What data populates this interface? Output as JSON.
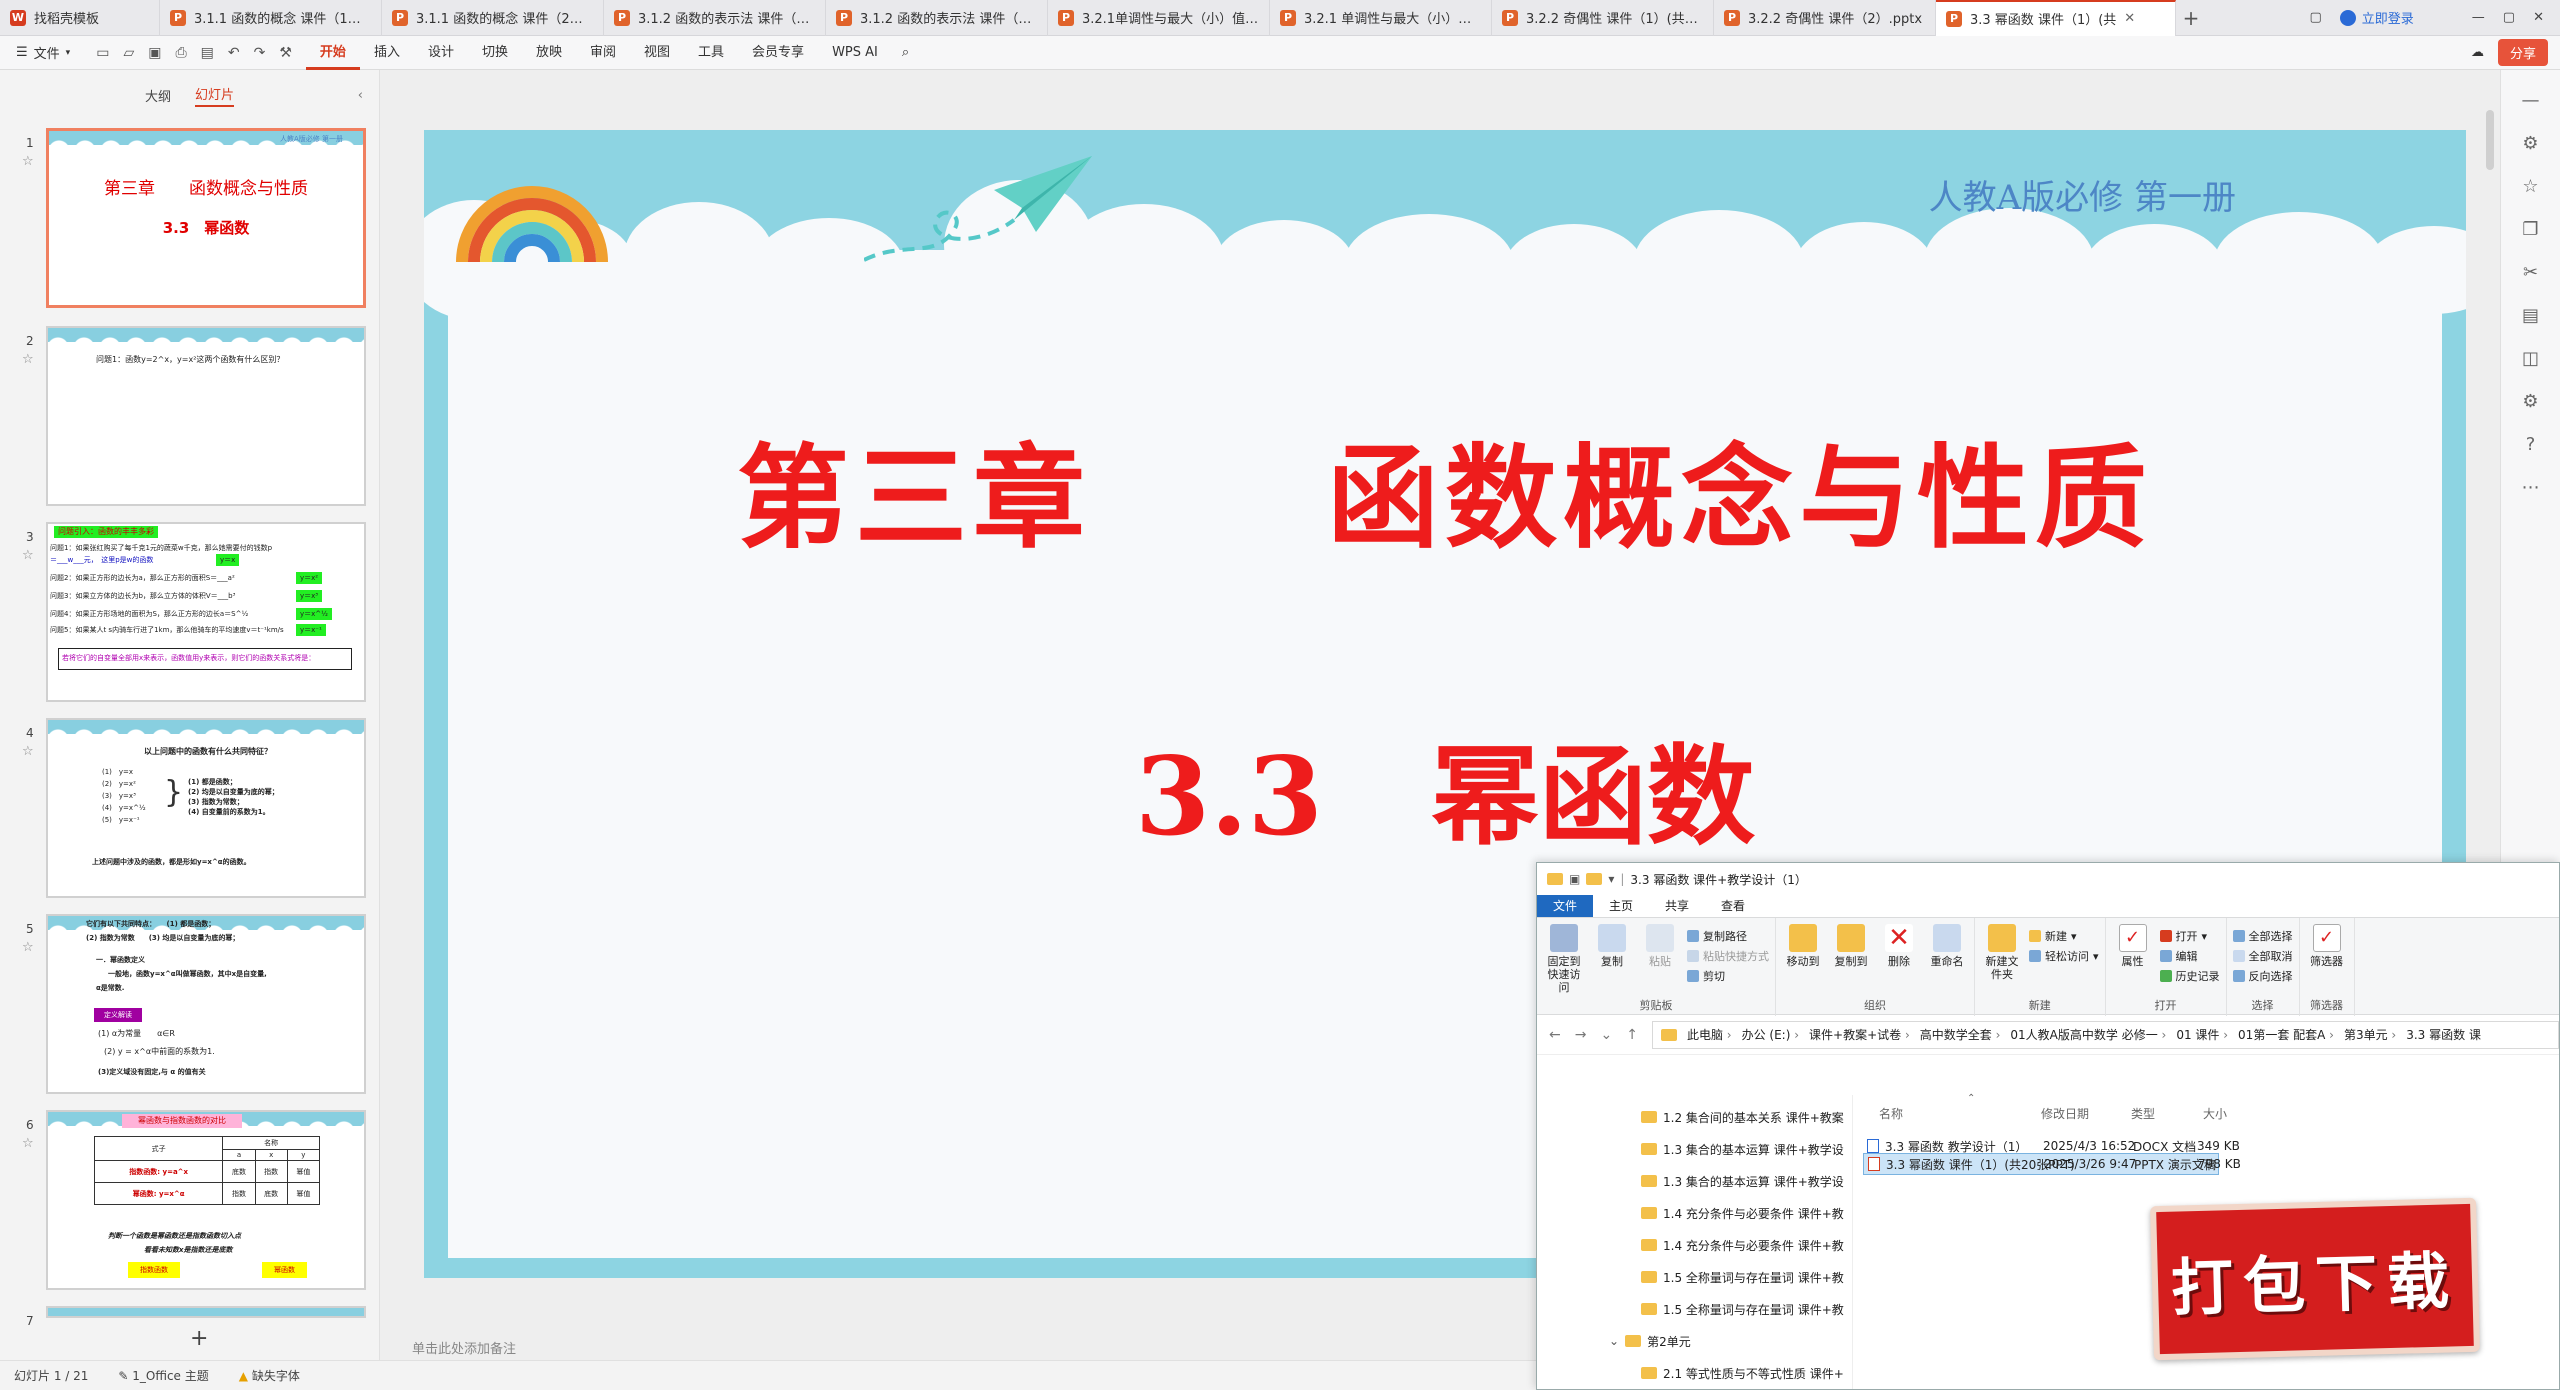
{
  "tabs": [
    {
      "label": "找稻壳模板",
      "icon": "wps-icon",
      "color": "#d63c1f",
      "letter": "W"
    },
    {
      "label": "3.1.1 函数的概念 课件（1）(共3",
      "icon": "ppt-icon",
      "color": "#e0632b",
      "letter": "P"
    },
    {
      "label": "3.1.1 函数的概念 课件（2）.pptx",
      "icon": "ppt-icon",
      "color": "#e0632b",
      "letter": "P"
    },
    {
      "label": "3.1.2 函数的表示法 课件（1）(共",
      "icon": "ppt-icon",
      "color": "#e0632b",
      "letter": "P"
    },
    {
      "label": "3.1.2 函数的表示法 课件（2）.p",
      "icon": "ppt-icon",
      "color": "#e0632b",
      "letter": "P"
    },
    {
      "label": "3.2.1单调性与最大（小）值 课件",
      "icon": "ppt-icon",
      "color": "#e0632b",
      "letter": "P"
    },
    {
      "label": "3.2.1 单调性与最大（小）值 课件",
      "icon": "ppt-icon",
      "color": "#e0632b",
      "letter": "P"
    },
    {
      "label": "3.2.2 奇偶性 课件（1）(共24张",
      "icon": "ppt-icon",
      "color": "#e0632b",
      "letter": "P"
    },
    {
      "label": "3.2.2 奇偶性 课件（2）.pptx",
      "icon": "ppt-icon",
      "color": "#e0632b",
      "letter": "P"
    },
    {
      "label": "3.3 幂函数 课件（1）(共",
      "icon": "ppt-icon",
      "color": "#e0632b",
      "letter": "P",
      "active": true
    }
  ],
  "login_label": "立即登录",
  "menu": {
    "file_label": "文件",
    "items": [
      "开始",
      "插入",
      "设计",
      "切换",
      "放映",
      "审阅",
      "视图",
      "工具",
      "会员专享",
      "WPS AI"
    ],
    "active": "开始",
    "share_label": "分享"
  },
  "panel": {
    "tab_outline": "大纲",
    "tab_slides": "幻灯片"
  },
  "thumbs": {
    "s1": {
      "num": "1",
      "line1": "第三章　　函数概念与性质",
      "line2": "3.3　幂函数",
      "corner": "人教A版必修 第一册"
    },
    "s2": {
      "num": "2",
      "line1": "问题1：函数y=2^x，y=x²这两个函数有什么区别？"
    },
    "s3": {
      "num": "3",
      "head": "问题引入：函数的丰丰多彩",
      "lines": [
        "问题1：如果张红购买了每千克1元的蔬菜w千克，那么她需要付的钱数p",
        "＝___w___元，　这里p是w的函数",
        "问题2：如果正方形的边长为a，那么正方形的面积S＝___a²",
        "问题3：如果立方体的边长为b，那么立方体的体积V＝___b³",
        "问题4：如果正方形场地的面积为S，那么正方形的边长a＝S^½",
        "问题5：如果某人t s内骑车行进了1km，那么他骑车的平均速度v＝t⁻¹km/s"
      ],
      "badges": [
        "y＝x",
        "y＝x²",
        "y＝x³",
        "y＝x^½",
        "y＝x⁻¹"
      ],
      "box": "若将它们的自变量全部用x来表示，函数值用y来表示，则它们的函数关系式将是："
    },
    "s4": {
      "num": "4",
      "head": "以上问题中的函数有什么共同特征？",
      "items": [
        "(1)　y=x",
        "(2)　y=x²",
        "(3)　y=x³",
        "(4)　y=x^½",
        "(5)　y=x⁻¹"
      ],
      "features": [
        "(1) 都是函数；",
        "(2) 均是以自变量为底的幂；",
        "(3) 指数为常数；",
        "(4) 自变量前的系数为1。"
      ],
      "foot": "上述问题中涉及的函数，都是形如y=x^α的函数。"
    },
    "s5": {
      "num": "5",
      "head": "它们有以下共同特点：　　(1) 都是函数；",
      "lines": [
        "(2) 指数为常数　　(3) 均是以自变量为底的幂；",
        "一．幂函数定义",
        "一般地，函数y=x^α叫做幂函数，其中x是自变量,",
        "α是常数."
      ],
      "tag": "定义解读",
      "notes": [
        "(1) α为常量　　α∈R",
        "(2) y = x^α中前面的系数为1.",
        "(3)定义域没有固定,与 α 的值有关"
      ]
    },
    "s6": {
      "num": "6",
      "head": "幂函数与指数函数的对比",
      "table": {
        "header": [
          "式子",
          "名称",
          "",
          ""
        ],
        "sub": [
          "",
          "a",
          "x",
          "y"
        ],
        "rows": [
          [
            "指数函数: y=a^x",
            "底数",
            "指数",
            "幂值"
          ],
          [
            "幂函数: y=x^α",
            "指数",
            "底数",
            "幂值"
          ]
        ]
      },
      "foot1": "判断一个函数是幂函数还是指数函数切入点",
      "foot2": "看看未知数x是指数还是底数",
      "chip1": "指数函数",
      "chip2": "幂函数"
    },
    "s7": {
      "num": "7"
    }
  },
  "slide": {
    "corner_label": "人教A版必修 第一册",
    "title_line1": "第三章　　函数概念与性质",
    "title_line2": "3.3　幂函数"
  },
  "notes_placeholder": "单击此处添加备注",
  "status": {
    "slide_pos": "幻灯片 1 / 21",
    "theme": "1_Office 主题",
    "font_warn": "缺失字体"
  },
  "explorer": {
    "window_title": "3.3 幂函数 课件+教学设计（1）",
    "tabs": [
      "文件",
      "主页",
      "共享",
      "查看"
    ],
    "ribbon": {
      "clipboard": {
        "name": "剪贴板",
        "pin": "固定到快速访问",
        "copy": "复制",
        "paste": "粘贴",
        "copy_path": "复制路径",
        "paste_shortcut": "粘贴快捷方式",
        "cut": "剪切"
      },
      "organize": {
        "name": "组织",
        "move": "移动到",
        "copyto": "复制到",
        "delete": "删除",
        "rename": "重命名"
      },
      "new": {
        "name": "新建",
        "newfolder": "新建文件夹",
        "newitem": "新建",
        "easy": "轻松访问"
      },
      "open": {
        "name": "打开",
        "props": "属性",
        "open": "打开",
        "edit": "编辑",
        "history": "历史记录"
      },
      "select": {
        "name": "选择",
        "all": "全部选择",
        "none": "全部取消",
        "invert": "反向选择"
      },
      "filter": {
        "name": "筛选器",
        "filter": "筛选器"
      }
    },
    "path": [
      "此电脑",
      "办公 (E:)",
      "课件+教案+试卷",
      "高中数学全套",
      "01人教A版高中数学 必修一",
      "01 课件",
      "01第一套 配套A",
      "第3单元",
      "3.3 幂函数 课"
    ],
    "tree": [
      "1.2 集合间的基本关系 课件+教案",
      "1.3 集合的基本运算 课件+教学设",
      "1.3 集合的基本运算 课件+教学设",
      "1.4 充分条件与必要条件 课件+教",
      "1.4 充分条件与必要条件 课件+教",
      "1.5 全称量词与存在量词 课件+教",
      "1.5 全称量词与存在量词 课件+教"
    ],
    "tree_unit": "第2单元",
    "tree_after": [
      "2.1 等式性质与不等式性质 课件+",
      "2.1 等式性质与不等式性质 课件+"
    ],
    "columns": {
      "name": "名称",
      "date": "修改日期",
      "type": "类型",
      "size": "大小"
    },
    "files": [
      {
        "name": "3.3 幂函数 教学设计（1）",
        "date": "2025/4/3 16:52",
        "type": "DOCX 文档",
        "size": "349 KB",
        "icon": "docx-icon"
      },
      {
        "name": "3.3 幂函数 课件（1）(共20张PPT)",
        "date": "2025/3/26 9:47",
        "type": "PPTX 演示文稿",
        "size": "798 KB",
        "icon": "pptx-icon",
        "selected": true
      }
    ]
  },
  "download_badge": "打包下载"
}
